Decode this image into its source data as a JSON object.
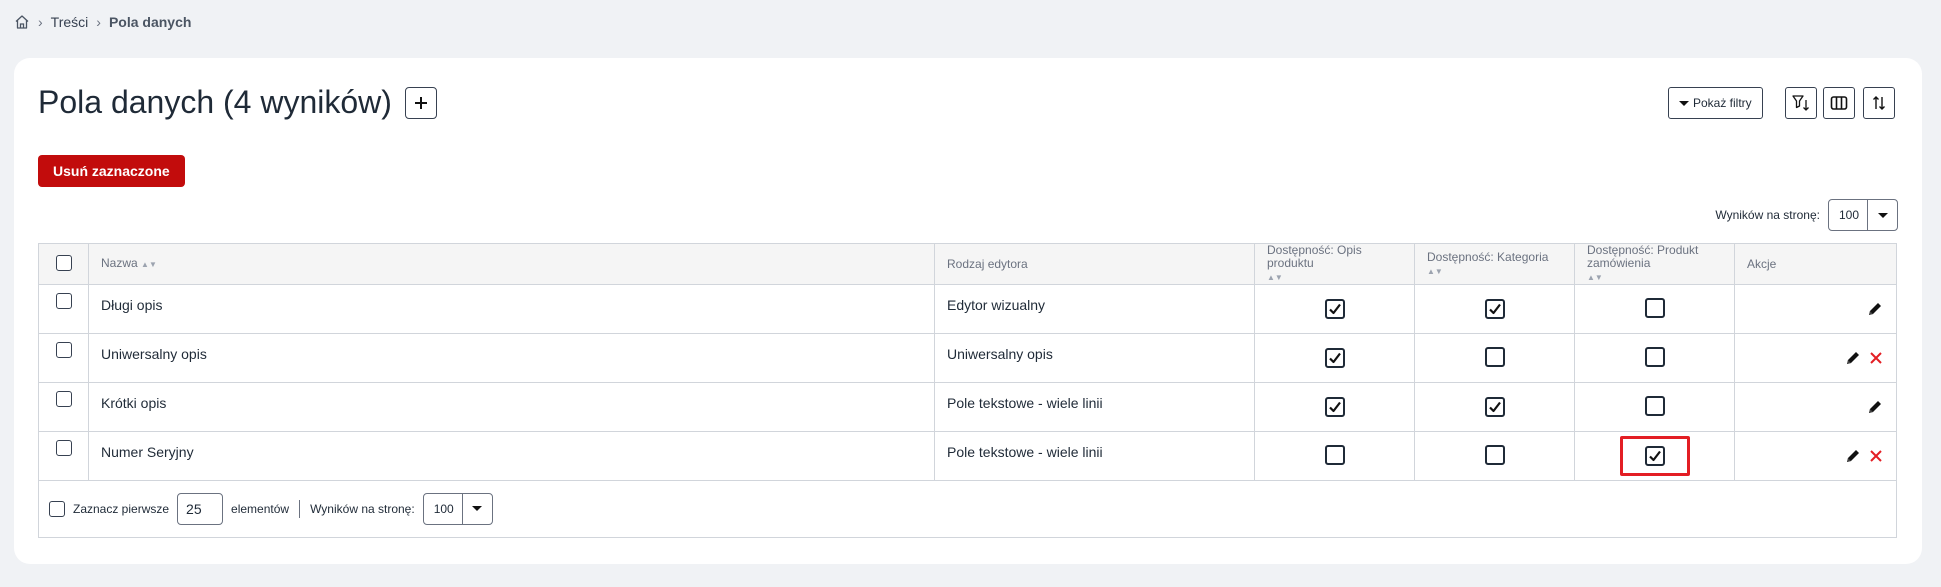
{
  "breadcrumb": {
    "home_icon": "home-icon",
    "items": [
      "Treści",
      "Pola danych"
    ]
  },
  "header": {
    "title": "Pola danych (4 wyników)",
    "add_icon": "plus-icon",
    "filters_label": "Pokaż filtry",
    "icons": [
      "filter-sort-icon",
      "columns-icon",
      "sort-arrows-icon"
    ]
  },
  "toolbar": {
    "delete_label": "Usuń zaznaczone",
    "per_page_label": "Wyników na stronę:",
    "per_page_value": "100"
  },
  "table": {
    "columns": {
      "name": "Nazwa",
      "editor": "Rodzaj edytora",
      "avail_desc": "Dostępność: Opis produktu",
      "avail_cat": "Dostępność: Kategoria",
      "avail_order": "Dostępność: Produkt zamówienia",
      "actions": "Akcje"
    },
    "rows": [
      {
        "name": "Długi opis",
        "editor": "Edytor wizualny",
        "desc": true,
        "cat": true,
        "order": false,
        "deletable": false
      },
      {
        "name": "Uniwersalny opis",
        "editor": "Uniwersalny opis",
        "desc": true,
        "cat": false,
        "order": false,
        "deletable": true
      },
      {
        "name": "Krótki opis",
        "editor": "Pole tekstowe - wiele linii",
        "desc": true,
        "cat": true,
        "order": false,
        "deletable": false
      },
      {
        "name": "Numer Seryjny",
        "editor": "Pole tekstowe - wiele linii",
        "desc": false,
        "cat": false,
        "order": true,
        "deletable": true
      }
    ]
  },
  "footer": {
    "select_first_label": "Zaznacz pierwsze",
    "select_first_value": "25",
    "elements_label": "elementów",
    "per_page_label": "Wyników na stronę:",
    "per_page_value": "100"
  },
  "colors": {
    "accent_red": "#c20c0c",
    "highlight": "#e31e24"
  }
}
